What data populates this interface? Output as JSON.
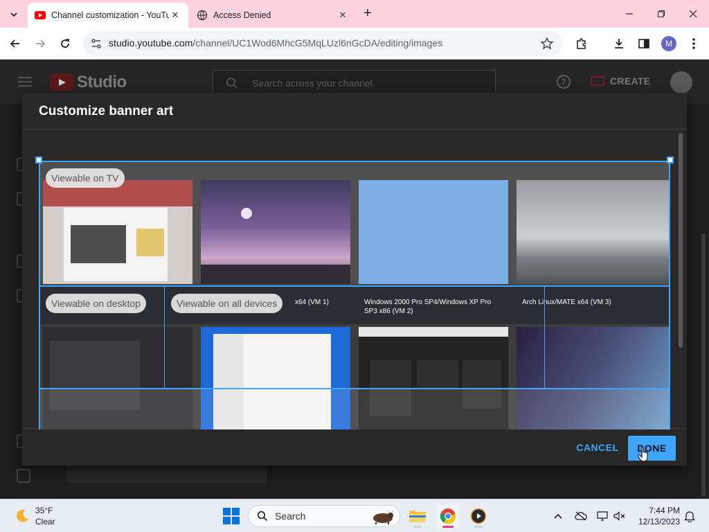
{
  "browser": {
    "tabs": [
      {
        "title": "Channel customization - YouTube",
        "active": true
      },
      {
        "title": "Access Denied",
        "active": false
      }
    ],
    "url": {
      "host": "studio.youtube.com",
      "path": "/channel/UC1Wod6MhcG5MqLUzl6nGcDA/editing/images"
    },
    "profile_initial": "M"
  },
  "studio": {
    "brand": "Studio",
    "search_placeholder": "Search across your channel",
    "create_label": "CREATE"
  },
  "modal": {
    "title": "Customize banner art",
    "cancel_label": "CANCEL",
    "done_label": "DONE",
    "zones": {
      "tv": "Viewable on TV",
      "desktop": "Viewable on desktop",
      "all": "Viewable on all devices"
    },
    "banner_captions": [
      "x64 (VM 1)",
      "Windows 2000 Pro SP4/Windows XP Pro SP3 x86 (VM 2)",
      "Arch Linux/MATE x64 (VM 3)"
    ]
  },
  "taskbar": {
    "weather": {
      "temp": "35°F",
      "condition": "Clear"
    },
    "search_label": "Search",
    "time": "7:44 PM",
    "date": "12/13/2023"
  },
  "colors": {
    "accent": "#3ea6ff",
    "tab_strip": "#fbd2dd",
    "yt_red": "#ff0000"
  }
}
